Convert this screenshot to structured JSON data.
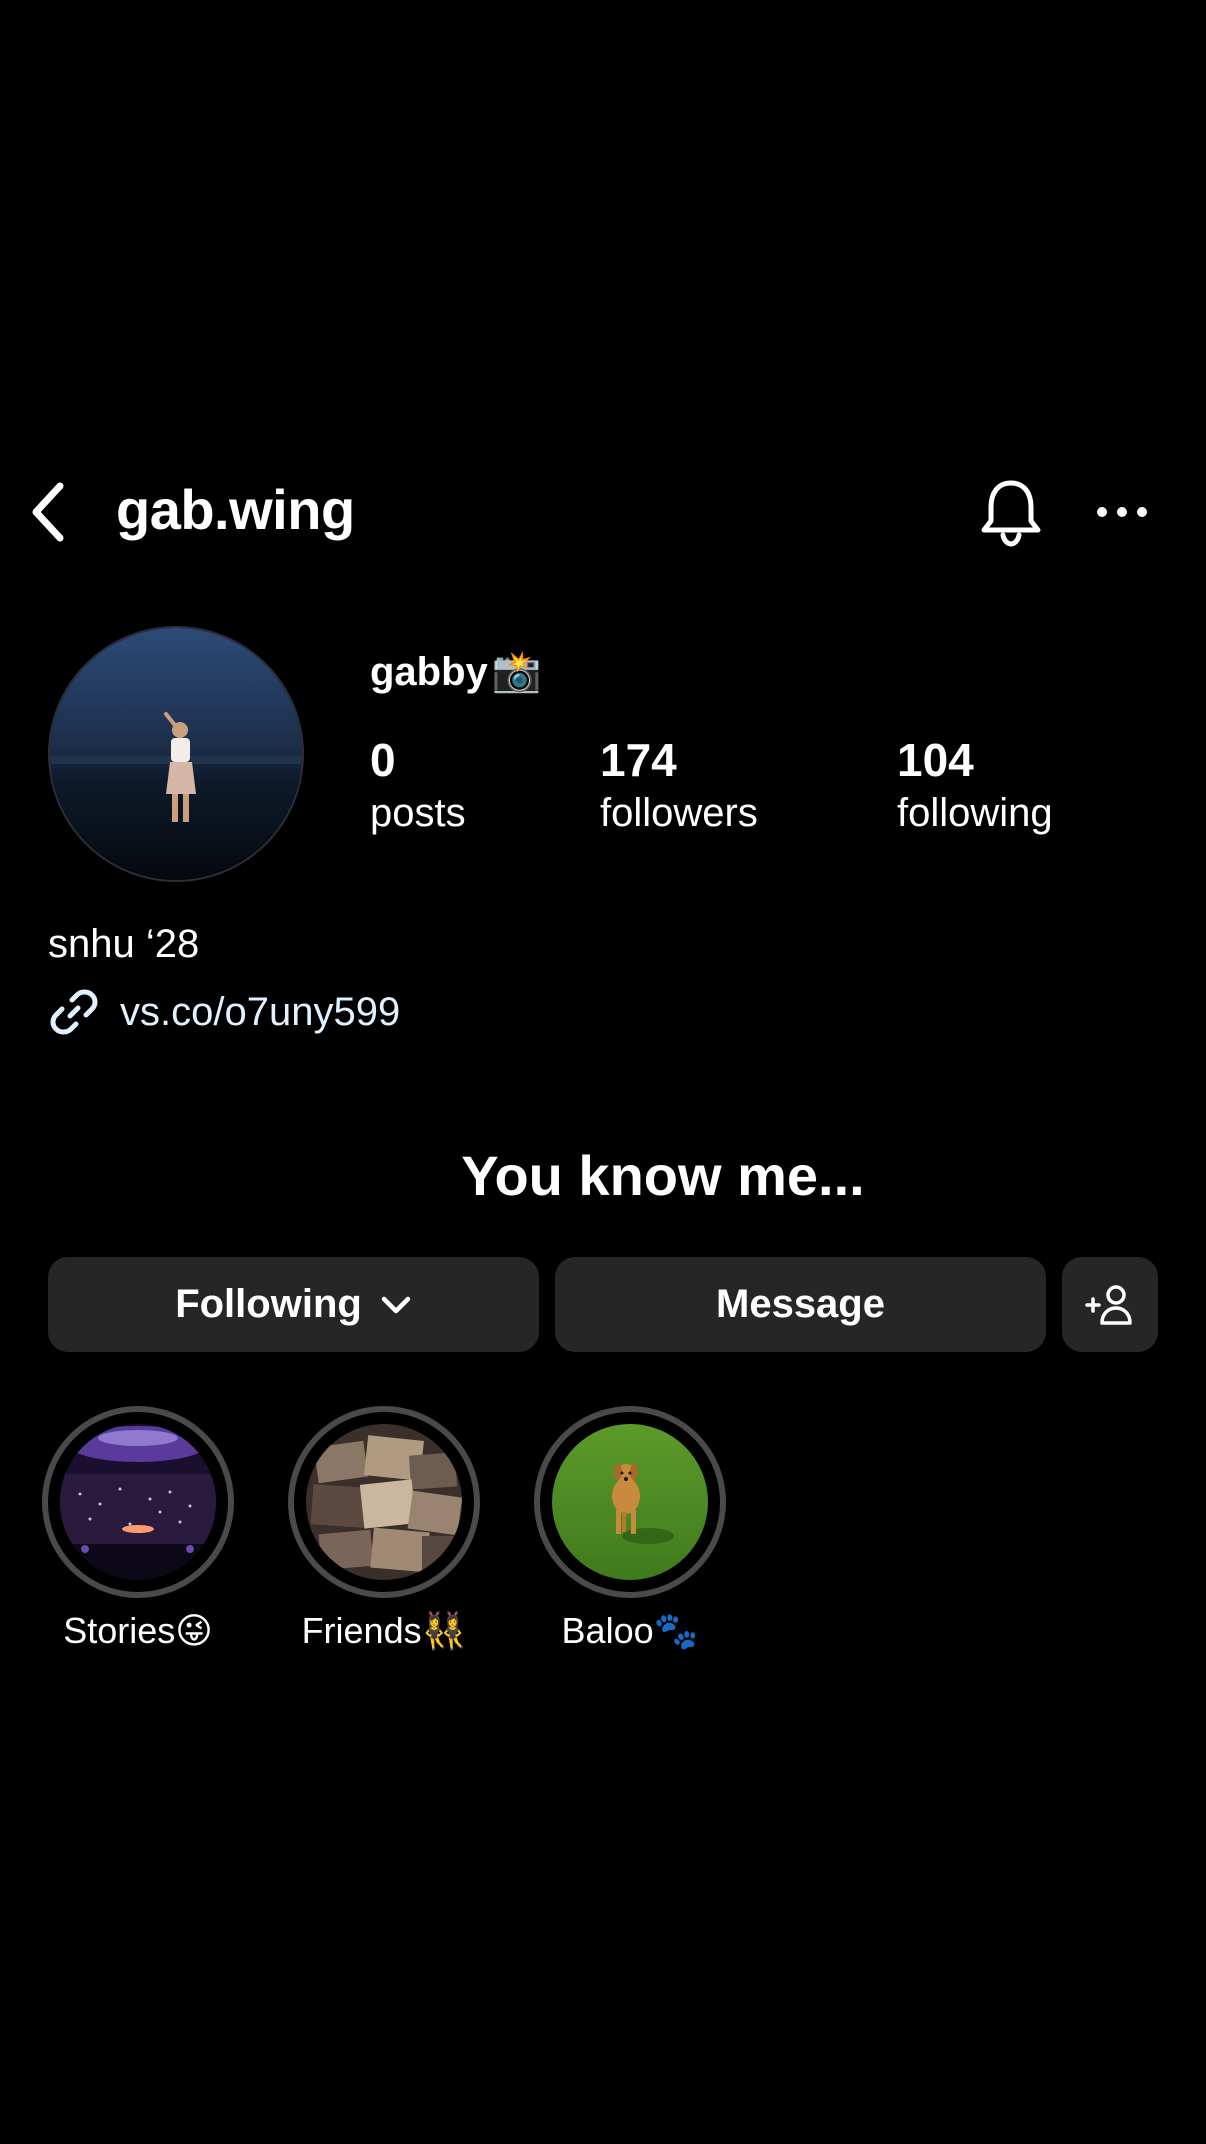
{
  "header": {
    "username": "gab.wing"
  },
  "profile": {
    "display_name": "gabby",
    "display_emoji": "📸",
    "stats": [
      {
        "value": "0",
        "label": "posts"
      },
      {
        "value": "174",
        "label": "followers"
      },
      {
        "value": "104",
        "label": "following"
      }
    ],
    "bio": "snhu ‘28",
    "link": "vs.co/o7uny599",
    "tagline": "You know me..."
  },
  "actions": {
    "following_label": "Following",
    "message_label": "Message"
  },
  "highlights": [
    {
      "label": "Stories😜",
      "icon": "concert-photo"
    },
    {
      "label": "Friends👯‍♀️",
      "icon": "collage-photo"
    },
    {
      "label": "Baloo🐾",
      "icon": "dog-photo"
    }
  ],
  "icons": {
    "back": "chevron-left-icon",
    "bell": "bell-icon",
    "more": "ellipsis-icon",
    "link": "link-icon",
    "chevron": "chevron-down-icon",
    "add_user": "add-user-icon"
  },
  "colors": {
    "background": "#000000",
    "button_bg": "#262626",
    "ring": "#4a4a4a",
    "link_text": "#e0f1ff"
  }
}
